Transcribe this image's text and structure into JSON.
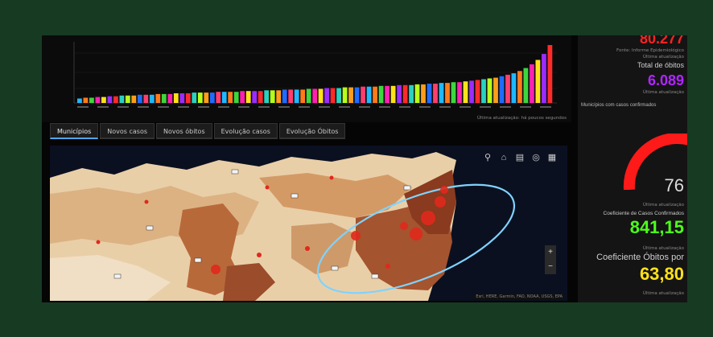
{
  "chart": {
    "bar_colors": [
      "#1fb8ff",
      "#ff7a1a",
      "#3dd63d",
      "#ff1fb0",
      "#ffe11a",
      "#9b2bff",
      "#ff2a2a",
      "#2ad1c0",
      "#b6ff1a",
      "#ff9d1a",
      "#1f6bff",
      "#ff3d6e"
    ],
    "values": [
      6,
      7,
      7,
      8,
      8,
      9,
      9,
      10,
      10,
      10,
      11,
      11,
      11,
      12,
      12,
      12,
      13,
      13,
      13,
      14,
      14,
      14,
      14,
      15,
      15,
      15,
      15,
      16,
      16,
      16,
      16,
      17,
      17,
      17,
      18,
      18,
      18,
      18,
      19,
      19,
      19,
      20,
      20,
      20,
      21,
      21,
      21,
      22,
      22,
      22,
      23,
      23,
      23,
      24,
      24,
      24,
      25,
      25,
      26,
      26,
      27,
      27,
      28,
      28,
      29,
      30,
      31,
      32,
      33,
      34,
      36,
      38,
      40,
      43,
      47,
      52,
      58,
      66,
      78
    ],
    "footer": "Última atualização: há poucos segundos"
  },
  "tabs": [
    "Municípios",
    "Novos casos",
    "Novos óbitos",
    "Evolução casos",
    "Evolução Óbitos"
  ],
  "map": {
    "zoom_in": "+",
    "zoom_out": "−",
    "attribution": "Esri, HERE, Garmin, FAO, NOAA, USGS, EPA"
  },
  "right": {
    "top_value": "80.277",
    "top_value_color": "#ff2222",
    "sub1": "Fonte: Informe Epidemiológico",
    "upd": "Última atualização",
    "deaths_label": "Total de óbitos",
    "deaths_value": "6.089",
    "deaths_color": "#b026ff",
    "confirmed_label": "Municípios com casos confirmados",
    "gauge_value": "76",
    "coef_label": "Coeficiente de Casos Confirmados",
    "coef_value": "841,15",
    "coef_color": "#4cff1a",
    "coef_deaths_label": "Coeficiente Óbitos por",
    "coef_deaths_value": "63,80",
    "coef_deaths_color": "#ffe11a"
  }
}
